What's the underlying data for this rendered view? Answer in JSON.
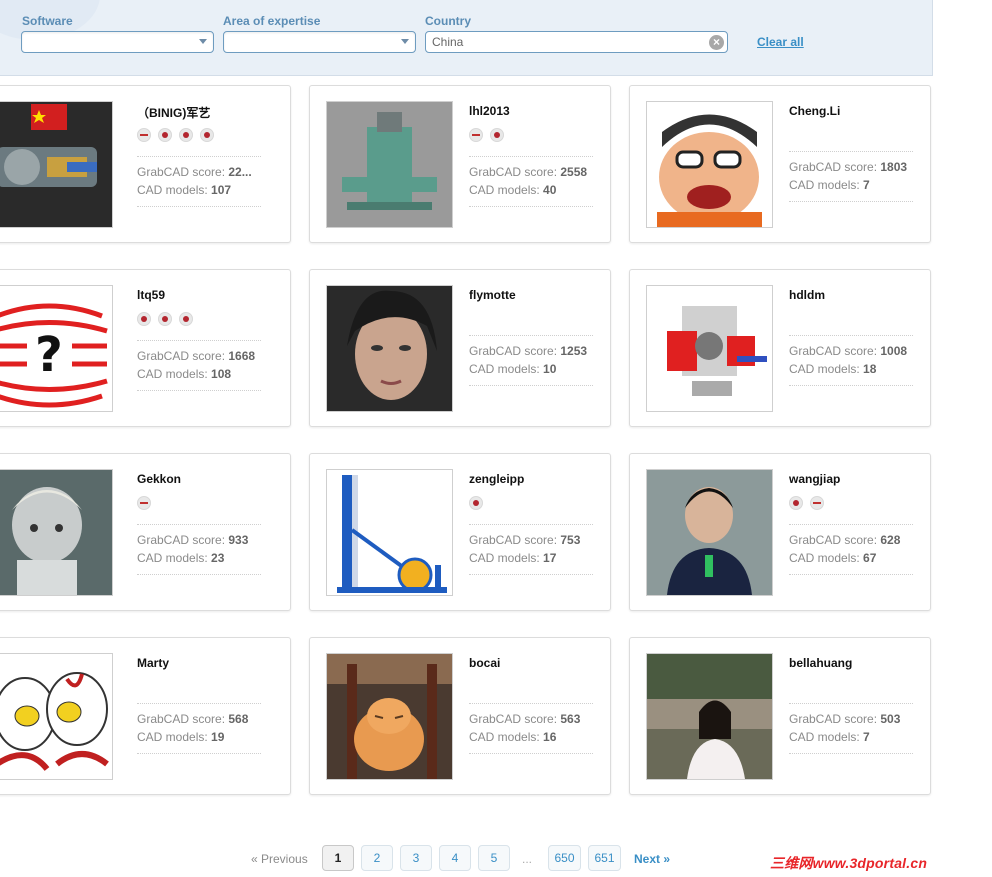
{
  "filters": {
    "software_label": "Software",
    "area_label": "Area of expertise",
    "country_label": "Country",
    "country_value": "China",
    "clear_all": "Clear all"
  },
  "stats_labels": {
    "score": "GrabCAD score: ",
    "models": "CAD models: "
  },
  "users": [
    {
      "name": "（BINIG)军艺",
      "score": "22...",
      "models": "107"
    },
    {
      "name": "lhl2013",
      "score": "2558",
      "models": "40"
    },
    {
      "name": "Cheng.Li",
      "score": "1803",
      "models": "7"
    },
    {
      "name": "ltq59",
      "score": "1668",
      "models": "108"
    },
    {
      "name": "flymotte",
      "score": "1253",
      "models": "10"
    },
    {
      "name": "hdldm",
      "score": "1008",
      "models": "18"
    },
    {
      "name": "Gekkon",
      "score": "933",
      "models": "23"
    },
    {
      "name": "zengleipp",
      "score": "753",
      "models": "17"
    },
    {
      "name": "wangjiap",
      "score": "628",
      "models": "67"
    },
    {
      "name": "Marty",
      "score": "568",
      "models": "19"
    },
    {
      "name": "bocai",
      "score": "563",
      "models": "16"
    },
    {
      "name": "bellahuang",
      "score": "503",
      "models": "7"
    }
  ],
  "pagination": {
    "previous": "« Previous",
    "pages": [
      "1",
      "2",
      "3",
      "4",
      "5",
      "650",
      "651"
    ],
    "ellipsis": "...",
    "next": "Next »"
  },
  "watermark": "三维网www.3dportal.cn"
}
